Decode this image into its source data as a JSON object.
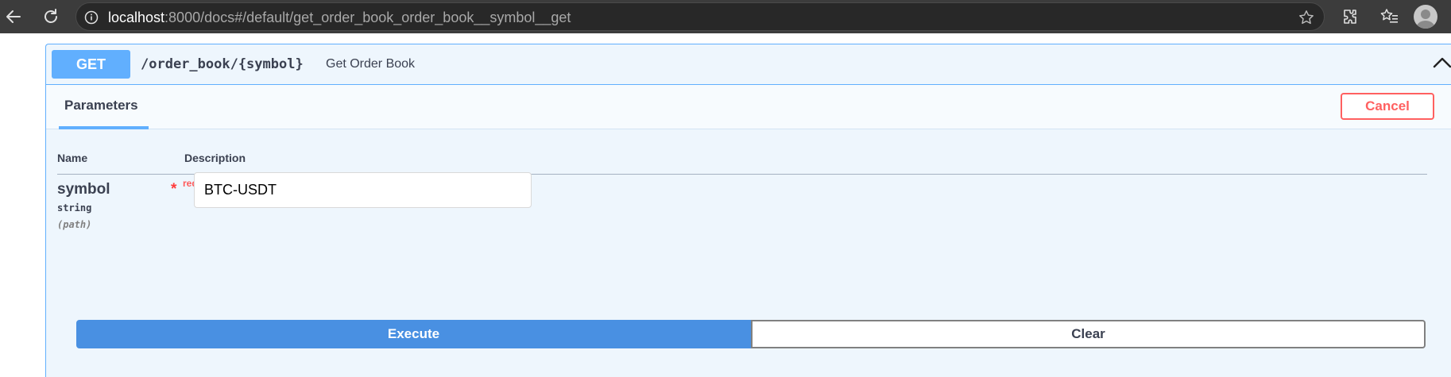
{
  "browser": {
    "url_host": "localhost",
    "url_rest": ":8000/docs#/default/get_order_book_order_book__symbol__get",
    "icons": {
      "back": "back-arrow-icon",
      "reload": "reload-icon",
      "site_info": "info-icon",
      "bookmark": "star-icon",
      "extensions": "puzzle-icon",
      "favorites": "favorites-icon",
      "profile": "profile-icon"
    }
  },
  "operation": {
    "method": "GET",
    "path": "/order_book/{symbol}",
    "summary": "Get Order Book",
    "collapse_icon": "chevron-up-icon",
    "colors": {
      "accent": "#61affe",
      "background": "#eef6fd",
      "cancel": "#ff6060",
      "execute": "#4990e2"
    }
  },
  "tabs": {
    "parameters_label": "Parameters",
    "cancel_label": "Cancel"
  },
  "parameters": {
    "headers": {
      "name": "Name",
      "description": "Description"
    },
    "items": [
      {
        "name": "symbol",
        "required_star": "*",
        "required_label": "required",
        "type": "string",
        "in": "(path)",
        "value": "BTC-USDT"
      }
    ]
  },
  "actions": {
    "execute_label": "Execute",
    "clear_label": "Clear"
  }
}
